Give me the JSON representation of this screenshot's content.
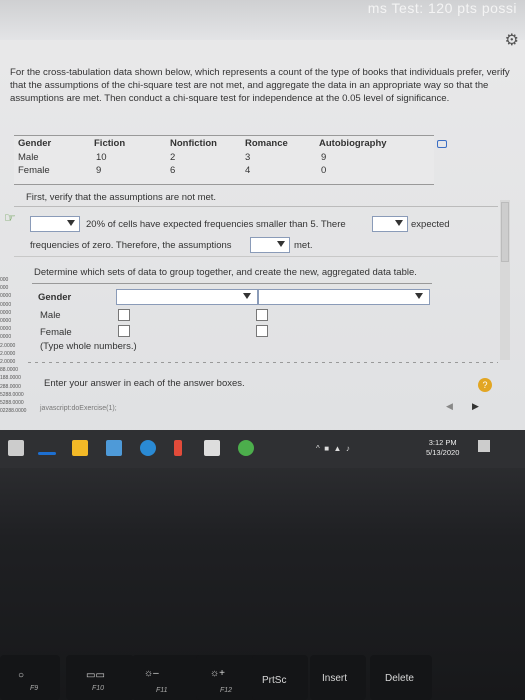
{
  "window": {
    "title_fragment": "ms Test: 120 pts possi"
  },
  "question": {
    "text": "For the cross-tabulation data shown below, which represents a count of the type of books that individuals prefer, verify that the assumptions of the chi-square test are not met, and aggregate the data in an appropriate way so that the assumptions are met. Then conduct a chi-square test for independence at the 0.05 level of significance."
  },
  "table": {
    "headers": [
      "Gender",
      "Fiction",
      "Nonfiction",
      "Romance",
      "Autobiography"
    ],
    "rows": [
      [
        "Male",
        "10",
        "2",
        "3",
        "9"
      ],
      [
        "Female",
        "9",
        "6",
        "4",
        "0"
      ]
    ]
  },
  "step1": {
    "intro": "First, verify that the assumptions are not met.",
    "text_a": "20% of cells have expected frequencies smaller than 5. There",
    "text_b": "expected",
    "text_c": "frequencies of zero. Therefore, the assumptions",
    "text_d": "met."
  },
  "step2": {
    "intro": "Determine which sets of data to group together, and create the new, aggregated data table.",
    "row_gender": "Gender",
    "row_male": "Male",
    "row_female": "Female",
    "note": "(Type whole numbers.)"
  },
  "footer": {
    "enter_answer": "Enter your answer in each of the answer boxes.",
    "status": "javascript:doExercise(1);",
    "help": "?"
  },
  "sidebar_values": [
    "000",
    "000",
    "0000",
    "0000",
    "0000",
    "0000",
    "0000",
    "0000",
    "2.0000",
    "2.0000",
    "2.0000",
    "88.0000",
    "188.0000",
    "288.0000",
    "5288.0000",
    "5288.0000",
    "02288.0000"
  ],
  "taskbar": {
    "clock_time": "3:12 PM",
    "clock_date": "5/13/2020"
  },
  "keyboard": {
    "keys": [
      {
        "name": "f9-key",
        "label": "F9",
        "icon": "lock-icon"
      },
      {
        "name": "f10-key",
        "label": "F10",
        "icon": "display-icon"
      },
      {
        "name": "f11-key",
        "label": "F11",
        "icon": "brightness-down-icon"
      },
      {
        "name": "f12-key",
        "label": "F12",
        "icon": "brightness-up-icon"
      },
      {
        "name": "prtsc-key",
        "label": "PrtSc"
      },
      {
        "name": "insert-key",
        "label": "Insert"
      },
      {
        "name": "delete-key",
        "label": "Delete"
      }
    ]
  },
  "colors": {
    "hand_icon": "#4a8f2e",
    "help_button": "#e2a623",
    "dropdown_border": "#8a9bb8"
  }
}
